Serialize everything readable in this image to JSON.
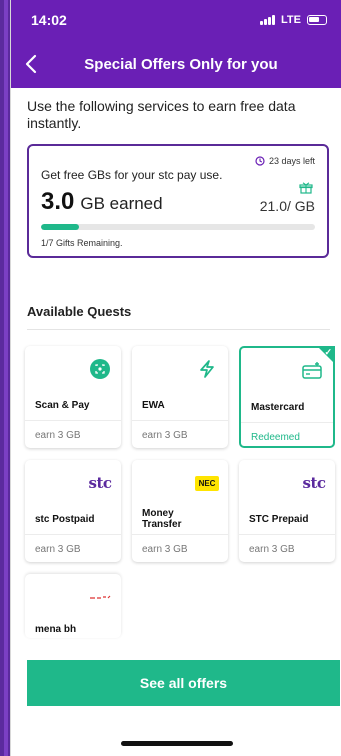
{
  "status_bar": {
    "time": "14:02",
    "network": "LTE"
  },
  "header": {
    "title": "Special Offers Only for you"
  },
  "intro_text": "Use the following services to earn free data instantly.",
  "earn_card": {
    "days_left": "23 days left",
    "headline": "Get free GBs for your stc pay use.",
    "earned_value": "3.0",
    "earned_label": "GB earned",
    "quota": "21.0/ GB",
    "progress_fraction": 0.14,
    "gifts_remaining": "1/7 Gifts Remaining."
  },
  "quests": {
    "title": "Available Quests",
    "items": [
      {
        "name": "Scan & Pay",
        "reward": "earn 3 GB",
        "icon": "scan-pay-icon"
      },
      {
        "name": "EWA",
        "reward": "earn 3 GB",
        "icon": "lightning-icon"
      },
      {
        "name": "Mastercard",
        "reward": "Redeemed",
        "icon": "card-icon",
        "selected": true
      },
      {
        "name": "stc Postpaid",
        "reward": "earn 3 GB",
        "icon": "stc-logo",
        "logo_text": "stc"
      },
      {
        "name": "Money Transfer",
        "reward": "earn 3 GB",
        "icon": "nec-logo",
        "logo_text": "NEC"
      },
      {
        "name": "STC Prepaid",
        "reward": "earn 3 GB",
        "icon": "stc-logo",
        "logo_text": "stc"
      },
      {
        "name": "mena bh",
        "reward": "",
        "icon": "mena-logo"
      }
    ]
  },
  "cta": {
    "label": "See all offers"
  },
  "colors": {
    "brand_purple": "#6a1fb5",
    "accent_green": "#1fb88a"
  }
}
